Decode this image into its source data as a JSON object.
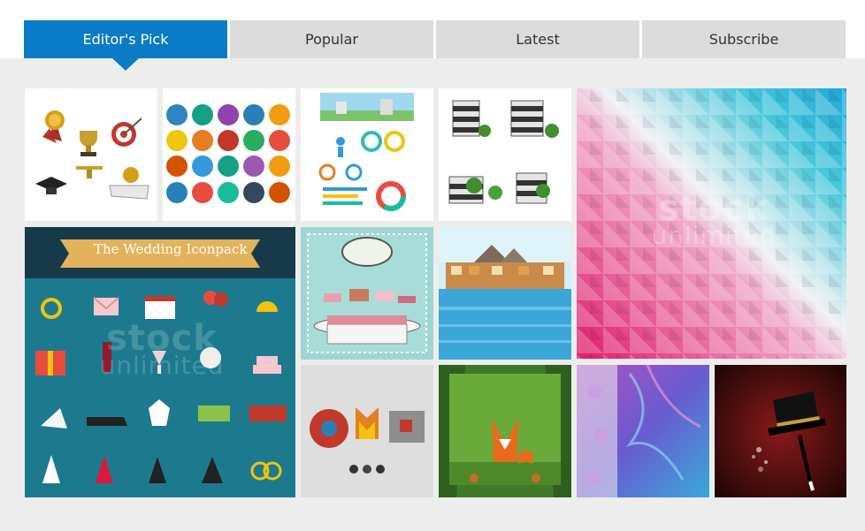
{
  "tabs": [
    {
      "label": "Editor's Pick",
      "active": true
    },
    {
      "label": "Popular",
      "active": false
    },
    {
      "label": "Latest",
      "active": false
    },
    {
      "label": "Subscribe",
      "active": false
    }
  ],
  "tiles": {
    "wedding": {
      "banner": "The Wedding Iconpack"
    },
    "watermark_primary": "stock",
    "watermark_secondary": "unlimited"
  },
  "colors": {
    "accent": "#0a7bc6",
    "tab_inactive": "#dcdcdc",
    "page_bg": "#ededed"
  }
}
